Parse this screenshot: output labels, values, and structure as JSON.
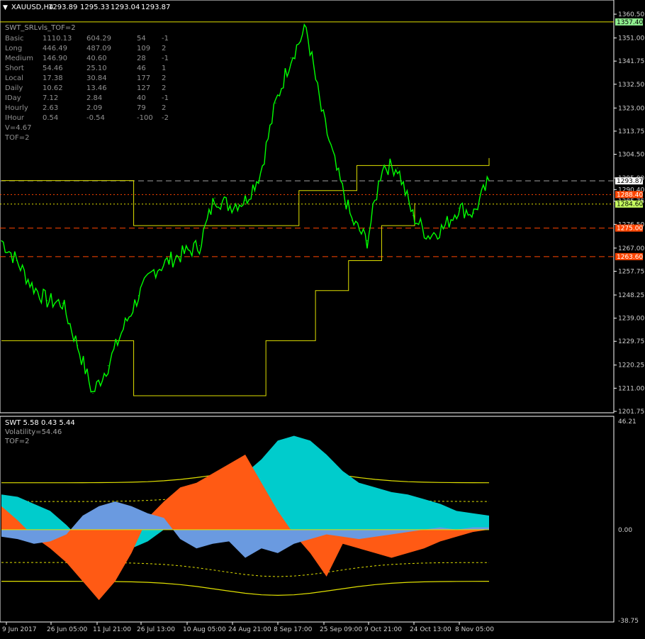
{
  "chart_data": [
    {
      "type": "line",
      "title": "XAUUSD,H4",
      "header": {
        "symbol": "XAUUSD,H4",
        "open": "1293.89",
        "high": "1295.33",
        "low": "1293.04",
        "close": "1293.87"
      },
      "ylim": [
        1201.75,
        1360.5
      ],
      "y_ticks": [
        "1360.50",
        "1351.00",
        "1341.75",
        "1332.50",
        "1323.00",
        "1313.75",
        "1304.50",
        "1295.00",
        "1290.40",
        "1285.75",
        "1276.50",
        "1267.00",
        "1257.75",
        "1248.25",
        "1239.00",
        "1229.75",
        "1220.25",
        "1211.00",
        "1201.75"
      ],
      "x_ticks": [
        "9 Jun 2017",
        "26 Jun 05:00",
        "11 Jul 21:00",
        "26 Jul 13:00",
        "10 Aug 05:00",
        "24 Aug 21:00",
        "8 Sep 17:00",
        "25 Sep 09:00",
        "9 Oct 21:00",
        "24 Oct 13:00",
        "8 Nov 05:00"
      ],
      "price_series": {
        "name": "XAUUSD close",
        "color": "#00ff00",
        "x": [
          "9 Jun",
          "14 Jun",
          "19 Jun",
          "24 Jun",
          "29 Jun",
          "4 Jul",
          "9 Jul",
          "14 Jul",
          "19 Jul",
          "24 Jul",
          "29 Jul",
          "3 Aug",
          "8 Aug",
          "13 Aug",
          "18 Aug",
          "23 Aug",
          "28 Aug",
          "2 Sep",
          "7 Sep",
          "12 Sep",
          "17 Sep",
          "22 Sep",
          "27 Sep",
          "2 Oct",
          "7 Oct",
          "12 Oct",
          "17 Oct",
          "22 Oct",
          "27 Oct",
          "1 Nov",
          "6 Nov",
          "11 Nov",
          "13 Nov"
        ],
        "values": [
          1270,
          1262,
          1252,
          1246,
          1245,
          1228,
          1209,
          1220,
          1235,
          1248,
          1258,
          1262,
          1265,
          1268,
          1287,
          1284,
          1286,
          1297,
          1325,
          1343,
          1355,
          1322,
          1298,
          1278,
          1270,
          1300,
          1299,
          1280,
          1272,
          1275,
          1283,
          1281,
          1294
        ]
      },
      "levels": [
        {
          "label": "1357.40",
          "value": 1357.4,
          "color": "#e0e000",
          "tag_bg": "#90ee90",
          "style": "solid"
        },
        {
          "label": "1293.87",
          "value": 1293.87,
          "color": "#a0a0a0",
          "tag_bg": "#ffffff",
          "style": "dashed"
        },
        {
          "label": "1288.40",
          "value": 1288.4,
          "color": "#ff4500",
          "tag_bg": "#ff4500",
          "style": "dotted"
        },
        {
          "label": "1284.60",
          "value": 1284.6,
          "color": "#e0e000",
          "tag_bg": "#c8ff60",
          "style": "dotted"
        },
        {
          "label": "1275.00",
          "value": 1275.0,
          "color": "#ff4500",
          "tag_bg": "#ff4500",
          "style": "dashed"
        },
        {
          "label": "1263.60",
          "value": 1263.6,
          "color": "#ff4500",
          "tag_bg": "#ff4500",
          "style": "dashed"
        }
      ],
      "support_resistance_steps": {
        "color": "#e0e000",
        "upper": [
          [
            0,
            1294
          ],
          [
            16,
            1294
          ],
          [
            16,
            1276
          ],
          [
            36,
            1276
          ],
          [
            36,
            1290
          ],
          [
            43,
            1290
          ],
          [
            43,
            1300
          ],
          [
            59,
            1300
          ],
          [
            59,
            1303
          ]
        ],
        "lower": [
          [
            0,
            1230
          ],
          [
            16,
            1230
          ],
          [
            16,
            1208
          ],
          [
            32,
            1208
          ],
          [
            32,
            1230
          ],
          [
            38,
            1230
          ],
          [
            38,
            1250
          ],
          [
            42,
            1250
          ],
          [
            42,
            1262
          ],
          [
            46,
            1262
          ],
          [
            46,
            1276
          ],
          [
            50,
            1276
          ],
          [
            50,
            1285
          ]
        ]
      },
      "legend_panel": {
        "title": "SWT_SRLvls_TOF=2",
        "rows": [
          [
            "Basic",
            "1110.13",
            "604.29",
            "54",
            "-1"
          ],
          [
            "Long",
            "446.49",
            "487.09",
            "109",
            "2"
          ],
          [
            "Medium",
            "146.90",
            "40.60",
            "28",
            "-1"
          ],
          [
            "Short",
            "54.46",
            "25.10",
            "46",
            "1"
          ],
          [
            "Local",
            "17.38",
            "30.84",
            "177",
            "2"
          ],
          [
            "Daily",
            "10.62",
            "13.46",
            "127",
            "2"
          ],
          [
            "IDay",
            "7.12",
            "2.84",
            "40",
            "-1"
          ],
          [
            "Hourly",
            "2.63",
            "2.09",
            "79",
            "2"
          ],
          [
            "IHour",
            "0.54",
            "-0.54",
            "-100",
            "-2"
          ]
        ],
        "footer": [
          "V=4.67",
          "TOF=2"
        ]
      }
    },
    {
      "type": "area",
      "title": "SWT 5.58 0.43 5.44",
      "lines": [
        "Volatility=54.46",
        "TOF=2"
      ],
      "ylim": [
        -38.75,
        46.21
      ],
      "y_ticks": [
        "46.21",
        "0.00",
        "-38.75"
      ],
      "series": [
        {
          "name": "cyan",
          "color": "#00cccc",
          "values": [
            15,
            14,
            11,
            8,
            2,
            -5,
            -10,
            -12,
            -8,
            -5,
            0,
            8,
            10,
            12,
            16,
            24,
            30,
            38,
            40,
            38,
            32,
            25,
            20,
            18,
            16,
            15,
            13,
            11,
            8,
            7,
            6
          ]
        },
        {
          "name": "orange",
          "color": "#ff5a14",
          "values": [
            10,
            4,
            -3,
            -8,
            -14,
            -22,
            -30,
            -22,
            -10,
            5,
            12,
            18,
            20,
            24,
            28,
            32,
            20,
            8,
            -2,
            -10,
            -20,
            -6,
            -8,
            -10,
            -12,
            -10,
            -8,
            -5,
            -3,
            -1,
            0
          ]
        },
        {
          "name": "blue",
          "color": "#6a9ae0",
          "values": [
            -3,
            -4,
            -6,
            -5,
            -2,
            6,
            10,
            12,
            10,
            7,
            5,
            -4,
            -8,
            -6,
            -5,
            -12,
            -8,
            -10,
            -6,
            -4,
            -2,
            -3,
            -4,
            -3,
            -2,
            -1,
            0,
            1,
            0,
            1,
            1
          ]
        }
      ]
    }
  ]
}
